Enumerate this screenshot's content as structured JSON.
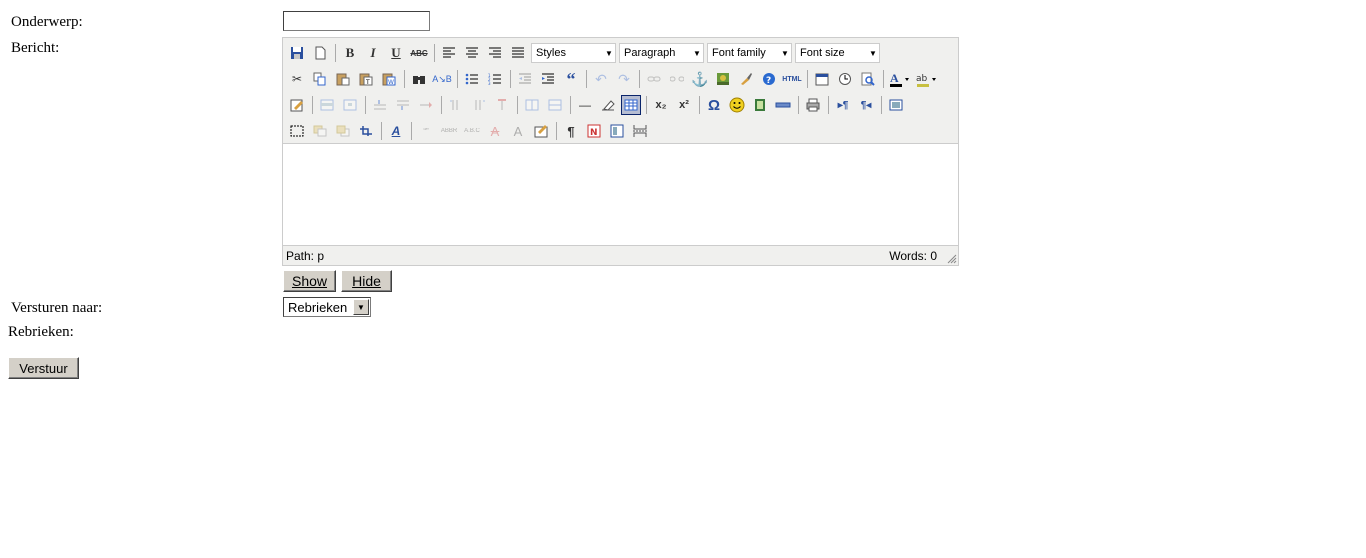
{
  "form": {
    "subject_label": "Onderwerp:",
    "subject_value": "",
    "message_label": "Bericht:",
    "send_to_label": "Versturen naar:",
    "send_to_selected": "Rebrieken",
    "rebrieken_label": "Rebrieken:",
    "submit_label": "Verstuur"
  },
  "editor": {
    "styles_label": "Styles",
    "format_label": "Paragraph",
    "font_family_label": "Font family",
    "font_size_label": "Font size",
    "path_text": "Path: p",
    "words_text": "Words: 0",
    "toolbar1_icons": [
      "save-icon",
      "new-document-icon",
      "bold-icon",
      "italic-icon",
      "underline-icon",
      "strikethrough-icon",
      "align-left-icon",
      "align-center-icon",
      "align-right-icon",
      "align-justify-icon"
    ],
    "toolbar2_icons": [
      "cut-icon",
      "copy-icon",
      "paste-icon",
      "paste-text-icon",
      "paste-word-icon",
      "find-icon",
      "replace-icon",
      "bullet-list-icon",
      "numbered-list-icon",
      "outdent-icon",
      "indent-icon",
      "blockquote-icon",
      "undo-icon",
      "redo-icon",
      "link-icon",
      "unlink-icon",
      "anchor-icon",
      "image-icon",
      "cleanup-icon",
      "help-icon",
      "html-icon",
      "insert-date-icon",
      "insert-time-icon",
      "preview-icon",
      "text-color-icon",
      "highlight-color-icon"
    ],
    "toolbar3_icons": [
      "edit-css-icon",
      "table-row-props-icon",
      "table-cell-props-icon",
      "insert-row-before-icon",
      "insert-row-after-icon",
      "delete-row-icon",
      "insert-col-before-icon",
      "insert-col-after-icon",
      "delete-col-icon",
      "split-cells-icon",
      "merge-cells-icon",
      "horizontal-rule-icon",
      "remove-format-icon",
      "visual-aid-icon",
      "subscript-icon",
      "superscript-icon",
      "special-char-icon",
      "emoticons-icon",
      "media-icon",
      "advanced-hr-icon",
      "print-icon",
      "ltr-icon",
      "rtl-icon",
      "fullscreen-icon"
    ],
    "toolbar4_icons": [
      "insert-layer-icon",
      "move-forward-icon",
      "move-backward-icon",
      "absolute-icon",
      "styleprops-icon",
      "cite-icon",
      "abbr-icon",
      "acronym-icon",
      "del-icon",
      "ins-icon",
      "attribs-icon",
      "visual-chars-icon",
      "nonbreaking-icon",
      "template-icon",
      "pagebreak-icon"
    ],
    "html_icon_text": "HTML",
    "subscript_text": "x₂",
    "superscript_text": "x²",
    "omega_text": "Ω",
    "pilcrow_text": "¶",
    "dash_text": "—"
  },
  "buttons": {
    "show_label": "Show",
    "hide_label": "Hide"
  }
}
